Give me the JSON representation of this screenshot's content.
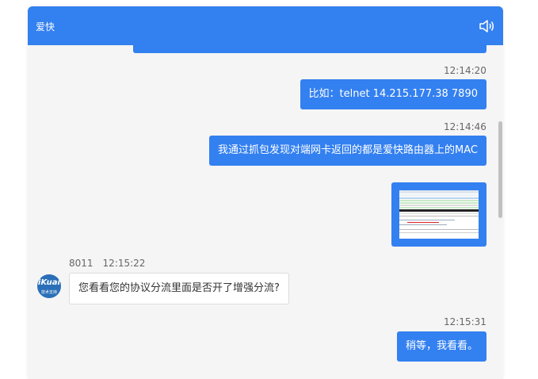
{
  "header": {
    "title": "爱快",
    "speaker_icon": "speaker-icon"
  },
  "messages": [
    {
      "time": "12:14:20",
      "text": "比如：telnet 14.215.177.38 7890"
    },
    {
      "time": "12:14:46",
      "text": "我通过抓包发现对端网卡返回的都是爱快路由器上的MAC"
    },
    {
      "image": "packet-capture-screenshot"
    },
    {
      "sender": "8011",
      "time": "12:15:22",
      "text": "您看看您的协议分流里面是否开了增强分流?"
    },
    {
      "time": "12:15:31",
      "text": "稍等，我看看。"
    }
  ],
  "avatar": {
    "logo": "iKuai",
    "subtitle": "技术支持"
  },
  "colors": {
    "accent": "#3380f0",
    "background": "#f5f5f5"
  }
}
